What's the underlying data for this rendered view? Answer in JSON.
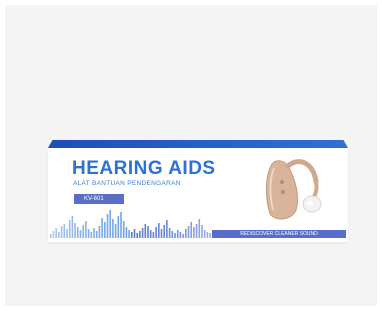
{
  "product": {
    "title": "HEARING AIDS",
    "subtitle": "ALAT BANTUAN PENDENGARAN",
    "model": "KV-601",
    "tagline": "REDISCOVER CLEANER SOUND"
  },
  "colors": {
    "brand_blue": "#2b72d2",
    "label_purple": "#5a6ec8",
    "device_beige": "#d9b49a"
  },
  "icons": [
    "sound-wave-graphic",
    "hearing-aid-device"
  ]
}
